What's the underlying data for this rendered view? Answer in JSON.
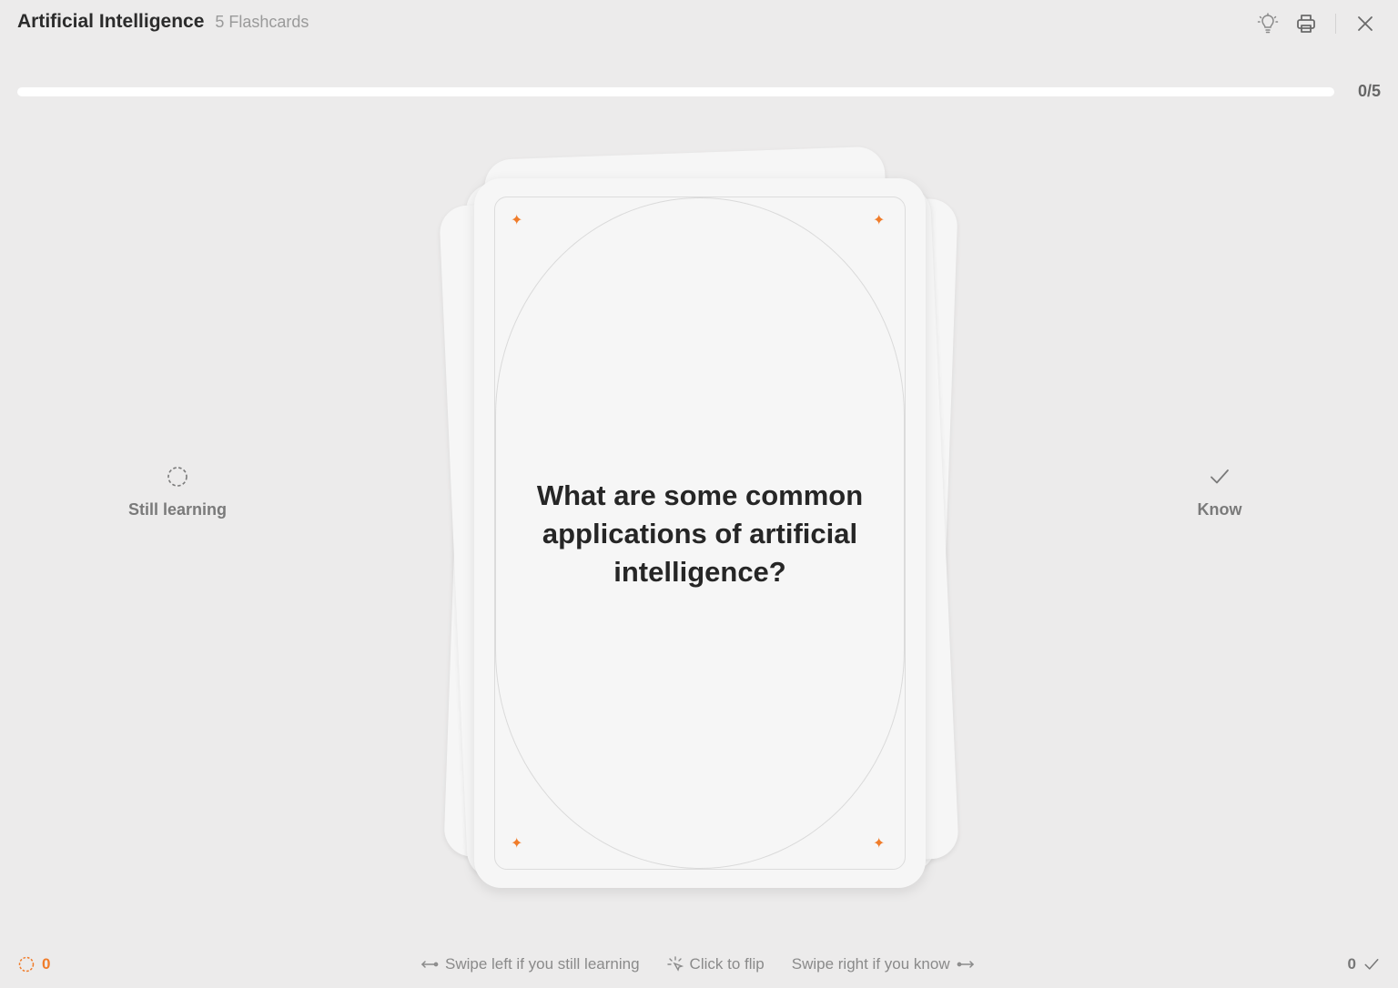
{
  "header": {
    "title": "Artificial Intelligence",
    "subtitle": "5 Flashcards"
  },
  "progress": {
    "label": "0/5",
    "fraction": 0
  },
  "actions": {
    "still_learning_label": "Still learning",
    "know_label": "Know"
  },
  "card": {
    "question": "What are some common applications of artificial intelligence?"
  },
  "footer": {
    "still_learning_count": "0",
    "know_count": "0",
    "hint_swipe_left": "Swipe left if you still learning",
    "hint_click_flip": "Click to flip",
    "hint_swipe_right": "Swipe right if you know"
  },
  "colors": {
    "accent": "#f07c2a",
    "background": "#ecebeb",
    "card": "#f6f6f6"
  }
}
